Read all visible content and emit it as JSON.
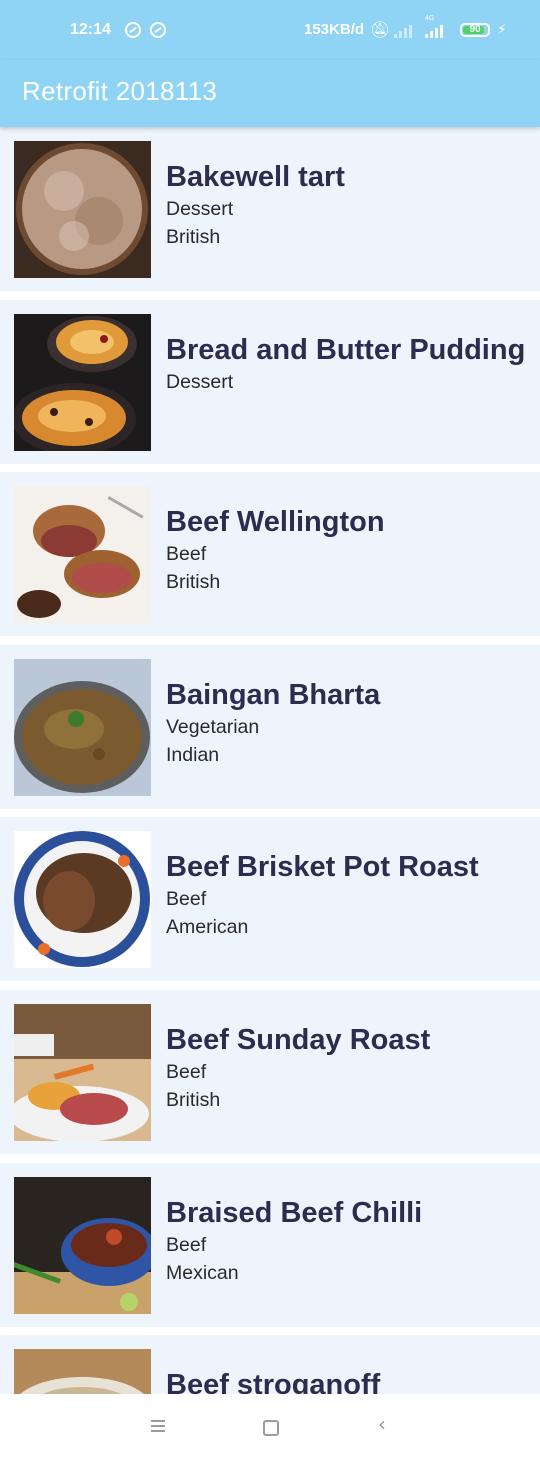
{
  "status_bar": {
    "time": "12:14",
    "network_speed": "153KB/d",
    "network_type": "4G",
    "battery_level": 0.9,
    "battery_label": "90",
    "colors": {
      "background": "#8fd3f5",
      "battery": "#4fd16b"
    }
  },
  "app_bar": {
    "title": "Retrofit 2018113",
    "color": "#8fd3f5"
  },
  "meals": [
    {
      "name": "Bakewell tart",
      "category": "Dessert",
      "area": "British"
    },
    {
      "name": "Bread and Butter Pudding",
      "category": "Dessert",
      "area": ""
    },
    {
      "name": "Beef Wellington",
      "category": "Beef",
      "area": "British"
    },
    {
      "name": "Baingan Bharta",
      "category": "Vegetarian",
      "area": "Indian"
    },
    {
      "name": "Beef Brisket Pot Roast",
      "category": "Beef",
      "area": "American"
    },
    {
      "name": "Beef Sunday Roast",
      "category": "Beef",
      "area": "British"
    },
    {
      "name": "Braised Beef Chilli",
      "category": "Beef",
      "area": "Mexican"
    },
    {
      "name": "Beef stroganoff",
      "category": "",
      "area": ""
    }
  ],
  "nav_bar": {
    "icons": [
      "menu-icon",
      "home-icon",
      "back-icon"
    ]
  }
}
